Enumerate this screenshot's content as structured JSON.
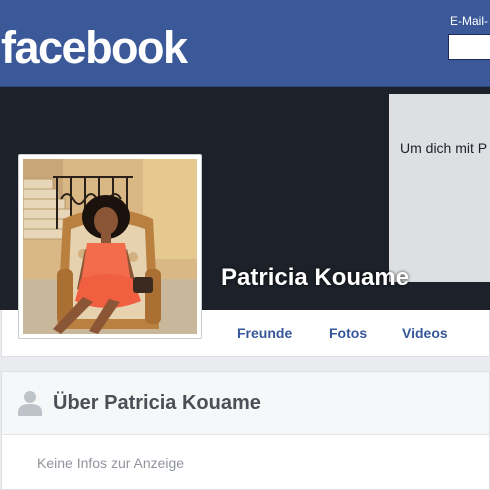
{
  "header": {
    "logo": "facebook",
    "email_label": "E-Mail-",
    "email_value": ""
  },
  "signup": {
    "text": "Um dich mit P"
  },
  "profile": {
    "name": "Patricia Kouame"
  },
  "nav": {
    "items": [
      {
        "label": "Freunde"
      },
      {
        "label": "Fotos"
      },
      {
        "label": "Videos"
      }
    ]
  },
  "about": {
    "title": "Über Patricia Kouame",
    "empty_text": "Keine Infos zur Anzeige"
  },
  "colors": {
    "brand": "#3b5998",
    "cover": "#1d2129",
    "link": "#365899",
    "muted": "#90949c"
  }
}
